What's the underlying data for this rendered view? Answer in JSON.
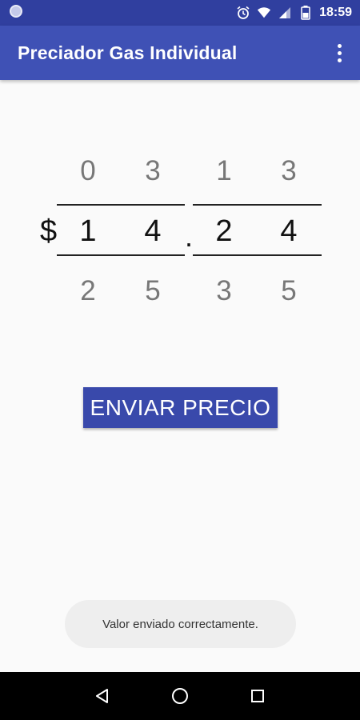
{
  "status_bar": {
    "time": "18:59",
    "icons": [
      "notification-dot-icon",
      "alarm-icon",
      "wifi-icon",
      "signal-icon",
      "battery-icon"
    ]
  },
  "app_bar": {
    "title": "Preciador Gas Individual",
    "menu_icon": "more-vert-icon"
  },
  "price_picker": {
    "currency_symbol": "$",
    "decimal_separator": ".",
    "wheels": [
      {
        "above": "0",
        "current": "1",
        "below": "2"
      },
      {
        "above": "3",
        "current": "4",
        "below": "5"
      },
      {
        "above": "1",
        "current": "2",
        "below": "3"
      },
      {
        "above": "3",
        "current": "4",
        "below": "5"
      }
    ]
  },
  "send_button": {
    "label": "ENVIAR PRECIO"
  },
  "toast": {
    "message": "Valor enviado correctamente."
  },
  "nav_bar": {
    "buttons": [
      "back-icon",
      "home-icon",
      "recents-icon"
    ]
  },
  "colors": {
    "status_bar": "#303f9f",
    "app_bar": "#3f51b5",
    "button": "#3949ab",
    "background": "#fafafa"
  }
}
